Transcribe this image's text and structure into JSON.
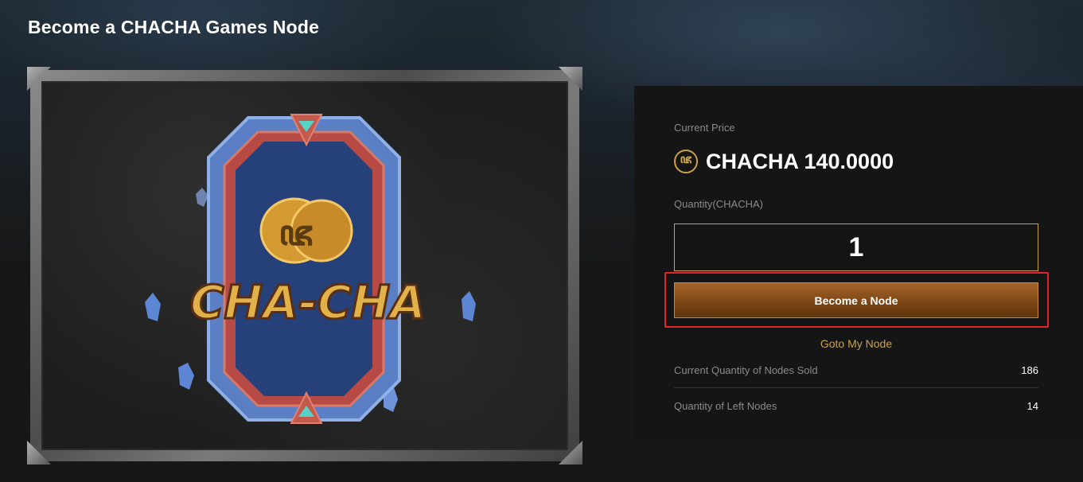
{
  "page": {
    "title": "Become a CHACHA Games Node"
  },
  "artwork": {
    "logo_text": "CHA-CHA",
    "logo_glyph": "ꦗ"
  },
  "panel": {
    "current_price_label": "Current Price",
    "coin_icon": "chacha-coin-icon",
    "price_text": "CHACHA 140.0000",
    "quantity_label": "Quantity(CHACHA)",
    "quantity_value": "1",
    "become_node_label": "Become a Node",
    "goto_label": "Goto My Node",
    "stats": [
      {
        "label": "Current Quantity of Nodes Sold",
        "value": "186"
      },
      {
        "label": "Quantity of Left Nodes",
        "value": "14"
      }
    ]
  },
  "colors": {
    "accent": "#c9a24a",
    "button": "#7d4715",
    "highlight": "#e0262b"
  }
}
